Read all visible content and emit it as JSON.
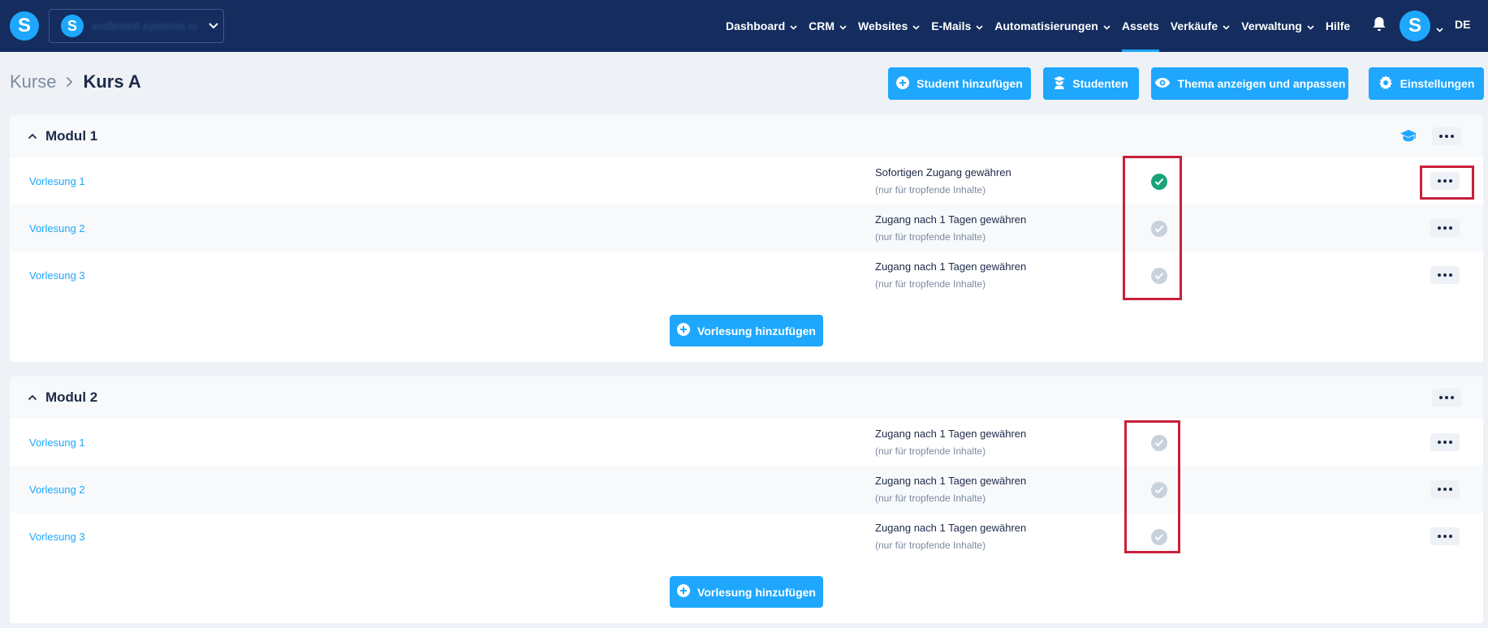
{
  "app": {
    "logo_letter": "S",
    "workspace": {
      "logo_letter": "S",
      "name": "svdlinde6.systeme.io"
    },
    "nav": [
      {
        "label": "Dashboard",
        "has_menu": true
      },
      {
        "label": "CRM",
        "has_menu": true
      },
      {
        "label": "Websites",
        "has_menu": true
      },
      {
        "label": "E-Mails",
        "has_menu": true
      },
      {
        "label": "Automatisierungen",
        "has_menu": true
      },
      {
        "label": "Assets",
        "has_menu": false,
        "active": true
      },
      {
        "label": "Verkäufe",
        "has_menu": true
      },
      {
        "label": "Verwaltung",
        "has_menu": true
      },
      {
        "label": "Hilfe",
        "has_menu": false
      }
    ],
    "avatar_letter": "S",
    "language": "DE"
  },
  "header": {
    "breadcrumb": {
      "parent": "Kurse",
      "current": "Kurs A"
    },
    "actions": {
      "add_student": "Student hinzufügen",
      "students": "Studenten",
      "theme": "Thema anzeigen und anpassen",
      "settings": "Einstellungen"
    }
  },
  "modules": [
    {
      "title": "Modul 1",
      "lectures": [
        {
          "name": "Vorlesung 1",
          "access": "Sofortigen Zugang gewähren",
          "note": "(nur für tropfende Inhalte)",
          "status": "checked"
        },
        {
          "name": "Vorlesung 2",
          "access": "Zugang nach 1 Tagen gewähren",
          "note": "(nur für tropfende Inhalte)",
          "status": "unchecked"
        },
        {
          "name": "Vorlesung 3",
          "access": "Zugang nach 1 Tagen gewähren",
          "note": "(nur für tropfende Inhalte)",
          "status": "unchecked"
        }
      ],
      "add_label": "Vorlesung hinzufügen"
    },
    {
      "title": "Modul 2",
      "lectures": [
        {
          "name": "Vorlesung 1",
          "access": "Zugang nach 1 Tagen gewähren",
          "note": "(nur für tropfende Inhalte)",
          "status": "unchecked"
        },
        {
          "name": "Vorlesung 2",
          "access": "Zugang nach 1 Tagen gewähren",
          "note": "(nur für tropfende Inhalte)",
          "status": "unchecked"
        },
        {
          "name": "Vorlesung 3",
          "access": "Zugang nach 1 Tagen gewähren",
          "note": "(nur für tropfende Inhalte)",
          "status": "unchecked"
        }
      ],
      "add_label": "Vorlesung hinzufügen"
    }
  ],
  "colors": {
    "navbar": "#142d5e",
    "accent": "#1ea7fd",
    "check_active": "#1aa37a",
    "check_inactive": "#c9d1db",
    "highlight": "#c8203a"
  }
}
